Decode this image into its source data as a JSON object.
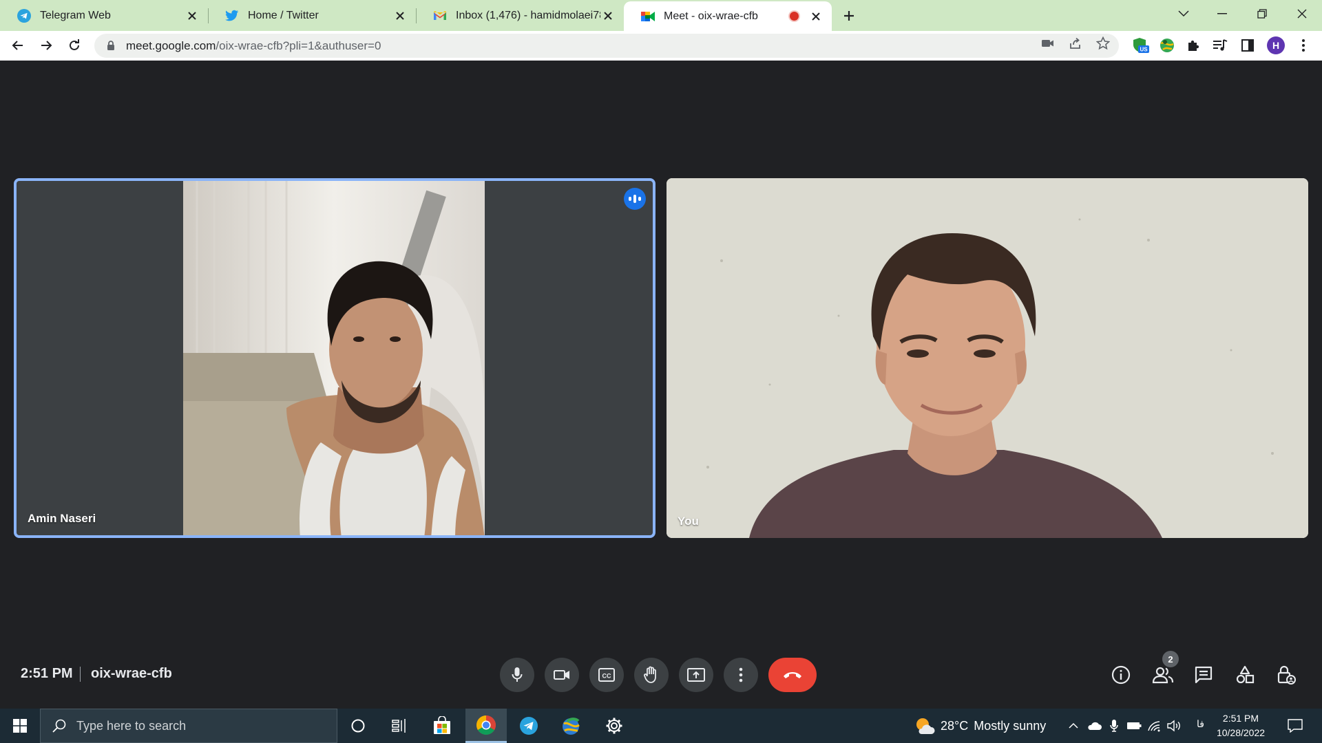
{
  "browser": {
    "tabs": [
      {
        "title": "Telegram Web",
        "icon": "telegram-icon",
        "active": false
      },
      {
        "title": "Home / Twitter",
        "icon": "twitter-icon",
        "active": false
      },
      {
        "title": "Inbox (1,476) - hamidmolaei78@",
        "icon": "gmail-icon",
        "active": false
      },
      {
        "title": "Meet - oix-wrae-cfb",
        "icon": "meet-icon",
        "active": true,
        "recording": true
      }
    ],
    "url_host": "meet.google.com",
    "url_path": "/oix-wrae-cfb?pli=1&authuser=0",
    "profile_initial": "H",
    "extension_badge": "US"
  },
  "meet": {
    "participants": [
      {
        "name": "Amin Naseri",
        "speaking": true
      },
      {
        "name": "You",
        "speaking": false
      }
    ],
    "time": "2:51 PM",
    "meeting_code": "oix-wrae-cfb",
    "people_count": "2"
  },
  "taskbar": {
    "search_placeholder": "Type here to search",
    "weather_temp": "28°C",
    "weather_text": "Mostly sunny",
    "language": "فا",
    "time": "2:51 PM",
    "date": "10/28/2022"
  },
  "colors": {
    "tab_strip": "#cfe8c4",
    "meet_bg": "#202124",
    "active_speaker_border": "#8ab4f8",
    "end_call": "#ea4335"
  }
}
